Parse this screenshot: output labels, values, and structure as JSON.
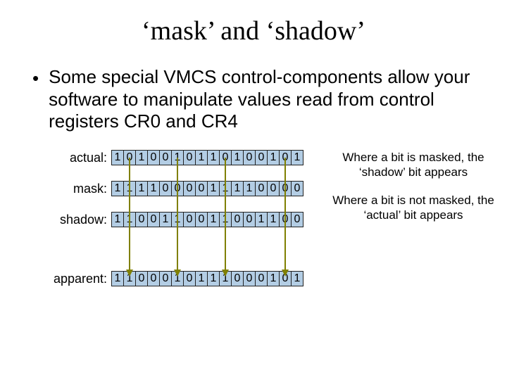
{
  "title": "‘mask’ and ‘shadow’",
  "bullet": "Some special VMCS control-components allow your software to manipulate values read from control registers CR0 and CR4",
  "labels": {
    "actual": "actual:",
    "mask": "mask:",
    "shadow": "shadow:",
    "apparent": "apparent:"
  },
  "bits": {
    "actual": [
      "1",
      "0",
      "1",
      "0",
      "0",
      "1",
      "0",
      "1",
      "1",
      "0",
      "1",
      "0",
      "0",
      "1",
      "0",
      "1"
    ],
    "mask": [
      "1",
      "1",
      "1",
      "1",
      "0",
      "0",
      "0",
      "0",
      "1",
      "1",
      "1",
      "1",
      "0",
      "0",
      "0",
      "0"
    ],
    "shadow": [
      "1",
      "1",
      "0",
      "0",
      "1",
      "1",
      "0",
      "0",
      "1",
      "1",
      "0",
      "0",
      "1",
      "1",
      "0",
      "0"
    ],
    "apparent": [
      "1",
      "1",
      "0",
      "0",
      "0",
      "1",
      "0",
      "1",
      "1",
      "1",
      "0",
      "0",
      "0",
      "1",
      "0",
      "1"
    ]
  },
  "captions": {
    "masked": "Where a bit is masked, the ‘shadow’ bit appears",
    "unmasked": "Where a bit is not masked, the ‘actual’ bit appears"
  },
  "arrow_color": "#808000",
  "row_y": {
    "actual": 0,
    "mask": 44,
    "shadow": 88,
    "apparent": 172
  },
  "arrow_x_indices": [
    1,
    5,
    9,
    14
  ]
}
